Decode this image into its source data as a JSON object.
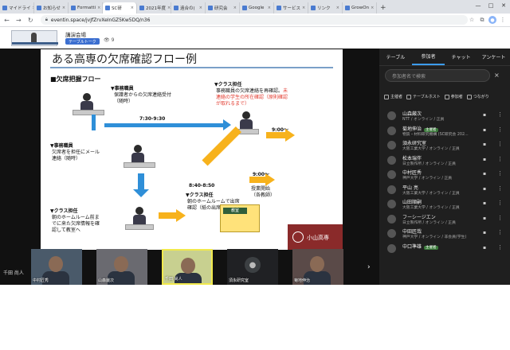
{
  "browser": {
    "tabs": [
      {
        "label": "マイドライ",
        "active": false
      },
      {
        "label": "お知らせ",
        "active": false
      },
      {
        "label": "Formatti",
        "active": false
      },
      {
        "label": "SC研",
        "active": true
      },
      {
        "label": "2021年度",
        "active": false
      },
      {
        "label": "遠合の(",
        "active": false
      },
      {
        "label": "研究会",
        "active": false
      },
      {
        "label": "Google",
        "active": false
      },
      {
        "label": "サービス",
        "active": false
      },
      {
        "label": "リンク",
        "active": false
      },
      {
        "label": "GrowOn",
        "active": false
      }
    ],
    "new_tab": "+",
    "url": "eventin.space/jvJfZrvXeInGZ5Kw5DQ/n36",
    "window_controls": [
      "—",
      "□",
      "✕"
    ]
  },
  "event": {
    "venue": "講演会場",
    "table_talk_label": "テーブルトーク",
    "viewer_count": "9"
  },
  "slide": {
    "title": "ある高専の欠席確認フロー例",
    "subtitle": "■欠席把握フロー",
    "office_heading": "▼事務職員",
    "office_text": "保護者からの欠席連絡受付\n（随時）",
    "time_1": "7:30-9:30",
    "office_mail_heading": "▼事務職員",
    "office_mail_text": "欠席者を担任にメール\n連絡（随時）",
    "homeroom_heading": "▼クラス担任",
    "homeroom_text": "朝のホームルーム前ま\nでに来た欠席情報を確\n認して教室へ",
    "class_teacher_top_heading": "▼クラス担任",
    "class_teacher_top_text": "事務職員の欠席連絡を再確認。",
    "class_teacher_top_red": "未\n連絡の学生の所在確認（原則確認\nが取れるまで）",
    "time_2": "9:00〜",
    "time_3": "8:40-8:50",
    "time_4": "9:00〜",
    "hr_heading": "▼クラス担任",
    "hr_text": "朝のホームルームで出席\n確認（紙の出席簿）",
    "class_start": "授業開始\n（各教師）",
    "classroom_board": "教室",
    "brand_name": "小山高専"
  },
  "presenter_label": "千田 尚人",
  "video_tiles": [
    {
      "name": "中村匠秀",
      "type": "camera",
      "speaking": false
    },
    {
      "name": "山森厳次",
      "type": "camera",
      "speaking": false
    },
    {
      "name": "千田 尚人",
      "type": "camera",
      "speaking": true
    },
    {
      "name": "須永研究室",
      "type": "avatar",
      "speaking": false
    },
    {
      "name": "菊地伸治",
      "type": "camera",
      "speaking": false
    }
  ],
  "panel": {
    "tabs": [
      {
        "label": "テーブル",
        "active": false
      },
      {
        "label": "参加者",
        "active": true
      },
      {
        "label": "チャット",
        "active": false
      },
      {
        "label": "アンケート",
        "active": false
      }
    ],
    "search_placeholder": "参加者名で検索",
    "clear": "×",
    "filters": [
      "主催者",
      "テーブルホスト",
      "参加者",
      "つながり"
    ],
    "participants": [
      {
        "name": "山森厳次",
        "badge": "",
        "affiliation": "NTT / オンライン / 正員"
      },
      {
        "name": "菊地伸治",
        "badge": "主催者",
        "affiliation": "物質・材料研究機構 (SC研究会 202..."
      },
      {
        "name": "須永研究室",
        "badge": "",
        "affiliation": "大阪工業大学 / オンライン / 正員"
      },
      {
        "name": "松本瑞伴",
        "badge": "",
        "affiliation": "日立製作所 / オンライン / 正員"
      },
      {
        "name": "中村匠秀",
        "badge": "",
        "affiliation": "神戸大学 / オンライン / 正員"
      },
      {
        "name": "平山 亮",
        "badge": "",
        "affiliation": "大阪工業大学 / オンライン / 正員"
      },
      {
        "name": "山田順嗣",
        "badge": "",
        "affiliation": "大阪工業大学 / オンライン / 正員"
      },
      {
        "name": "フーシージエン",
        "badge": "",
        "affiliation": "日立製作所 / オンライン / 正員"
      },
      {
        "name": "中田匠哉",
        "badge": "",
        "affiliation": "神戸大学 / オンライン / 非会員(学生)"
      },
      {
        "name": "中口準雄",
        "badge": "主催者",
        "affiliation": ""
      }
    ],
    "chat_icon": "▪",
    "more_icon": "⋮"
  }
}
